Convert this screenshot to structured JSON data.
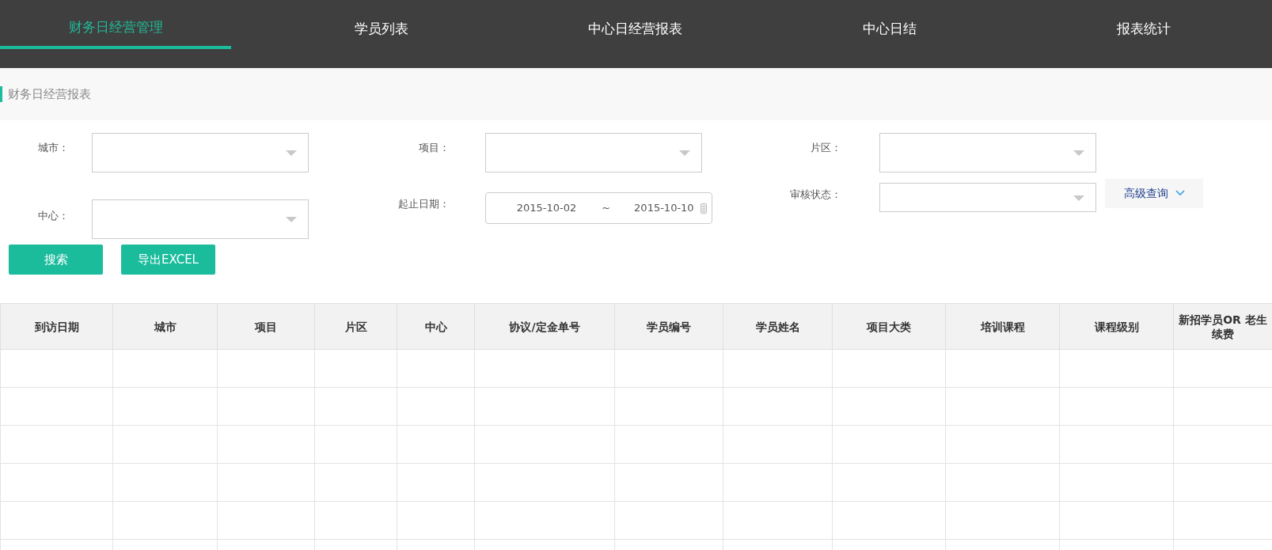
{
  "tabs": [
    {
      "label": "财务日经营管理",
      "selected": true
    },
    {
      "label": "学员列表",
      "selected": false
    },
    {
      "label": "中心日经营报表",
      "selected": false
    },
    {
      "label": "中心日结",
      "selected": false
    },
    {
      "label": "报表统计",
      "selected": false
    }
  ],
  "breadcrumb": "财务日经营报表",
  "filter_rows": [
    [
      {
        "kind": "select",
        "label": "城市："
      },
      {
        "kind": "select",
        "label": "项目："
      },
      {
        "kind": "select",
        "label": "片区："
      }
    ],
    [
      {
        "kind": "select",
        "label": "中心："
      },
      {
        "kind": "daterange",
        "label": "起止日期：",
        "start": "2015-10-02",
        "separator": "~",
        "end": "2015-10-10"
      },
      {
        "kind": "select",
        "label": "审核状态："
      }
    ]
  ],
  "advanced_query": "高级查询",
  "buttons": [
    "搜索",
    "导出EXCEL"
  ],
  "table": {
    "columns": [
      "到访日期",
      "城市",
      "项目",
      "片区",
      "中心",
      "协议/定金单号",
      "学员编号",
      "学员姓名",
      "项目大类",
      "培训课程",
      "课程级别",
      "新招学员OR 老生续费"
    ]
  }
}
